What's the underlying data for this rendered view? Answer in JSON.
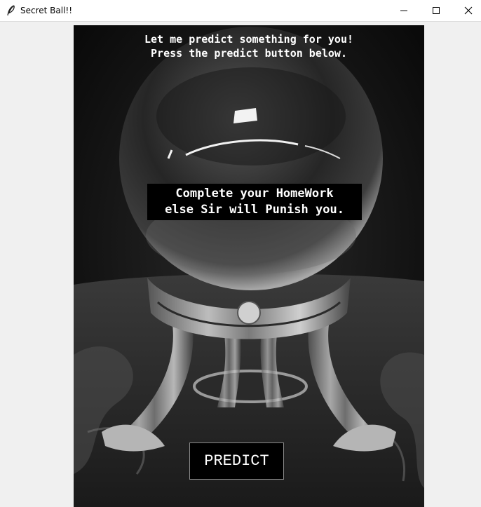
{
  "window": {
    "title": "Secret Ball!!",
    "icon": "feather-icon",
    "controls": [
      "minimize-icon",
      "maximize-icon",
      "close-icon"
    ]
  },
  "app": {
    "header_text": "Let me predict something for you!\nPress the predict button below.",
    "prediction_text": "Complete your HomeWork\nelse Sir will Punish you.",
    "predict_label": "PREDICT",
    "background_image": "crystal ball on ornate metal stand (black and white photo)"
  },
  "colors": {
    "canvas_bg": "#000000",
    "text": "#ffffff",
    "window_bg": "#f0f0f0",
    "titlebar_bg": "#ffffff"
  }
}
